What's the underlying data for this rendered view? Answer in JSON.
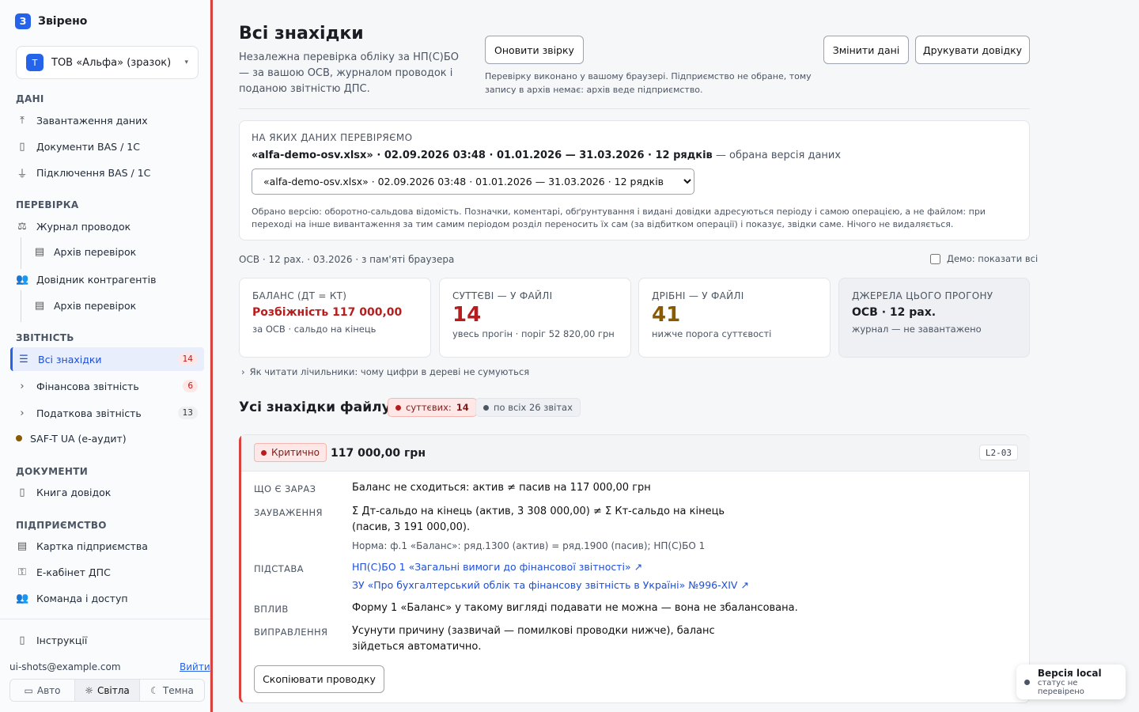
{
  "app": {
    "logo_letter": "З",
    "name": "Звірено"
  },
  "org": {
    "avatar": "Т",
    "name": "ТОВ «Альфа» (зразок)"
  },
  "sidebar": {
    "sections": {
      "data": "ДАНІ",
      "check": "ПЕРЕВІРКА",
      "report": "ЗВІТНІСТЬ",
      "docs": "ДОКУМЕНТИ",
      "enterprise": "ПІДПРИЄМСТВО"
    },
    "items": {
      "upload": "Завантаження даних",
      "bas_docs": "Документи BAS / 1С",
      "bas_conn": "Підключення BAS / 1С",
      "journal": "Журнал проводок",
      "archive1": "Архів перевірок",
      "contractors": "Довідник контрагентів",
      "archive2": "Архів перевірок",
      "all_findings": "Всі знахідки",
      "all_findings_count": "14",
      "fin_report": "Фінансова звітність",
      "fin_report_count": "6",
      "tax_report": "Податкова звітність",
      "tax_report_count": "13",
      "saft": "SAF-T UA (е-аудит)",
      "book": "Книга довідок",
      "card": "Картка підприємства",
      "cabinet": "Е-кабінет ДПС",
      "team": "Команда і доступ",
      "instructions": "Інструкції"
    },
    "email": "ui-shots@example.com",
    "logout": "Вийти",
    "theme": {
      "auto": "Авто",
      "light": "Світла",
      "dark": "Темна"
    }
  },
  "header": {
    "title": "Всі знахідки",
    "intro": "Незалежна перевірка обліку за НП(С)БО — за вашою ОСВ, журналом проводок і поданою звітністю ДПС.",
    "refresh": "Оновити звірку",
    "note": "Перевірку виконано у вашому браузері. Підприємство не обране, тому запису в архів немає: архів веде підприємство.",
    "change": "Змінити дані",
    "print": "Друкувати довідку"
  },
  "dataset": {
    "label": "НА ЯКИХ ДАНИХ ПЕРЕВІРЯЄМО",
    "current": "«alfa-demo-osv.xlsx» · 02.09.2026 03:48 · 01.01.2026 — 31.03.2026 · 12 рядків",
    "current_suffix": "— обрана версія даних",
    "select_value": "«alfa-demo-osv.xlsx» · 02.09.2026 03:48 · 01.01.2026 — 31.03.2026 · 12 рядків",
    "desc": "Обрано версію: оборотно-сальдова відомість. Позначки, коментарі, обґрунтування і видані довідки адресуються періоду і самою операцією, а не файлом: при переході на інше вивантаження за тим самим періодом розділ переносить їх сам (за відбитком операції) і показує, звідки саме. Нічого не видаляється."
  },
  "meta": {
    "left": "ОСВ · 12 рах. · 03.2026 · з пам'яті браузера",
    "demo": "Демо: показати всі"
  },
  "stats": [
    {
      "title": "БАЛАНС (ДТ = КТ)",
      "value": "Розбіжність 117 000,00",
      "sub": "за ОСВ · сальдо на кінець"
    },
    {
      "title": "СУТТЄВІ — У ФАЙЛІ",
      "value": "14",
      "sub": "увесь прогін · поріг 52 820,00 грн"
    },
    {
      "title": "ДРІБНІ — У ФАЙЛІ",
      "value": "41",
      "sub": "нижче порога суттєвості"
    },
    {
      "title": "ДЖЕРЕЛА ЦЬОГО ПРОГОНУ",
      "value": "ОСВ · 12 рах.",
      "sub": "журнал — не завантажено"
    }
  ],
  "colors": {
    "accent": "#2563eb",
    "danger": "#b91c1c",
    "gold": "#8a5a00",
    "rail": "#d9433d"
  },
  "howto": "Як читати лічильники: чому цифри в дереві не сумуються",
  "findings": {
    "title": "Усі знахідки файлу",
    "chip1_label": "суттєвих:",
    "chip1_count": "14",
    "chip2": "по всіх 26 звітах"
  },
  "finding": {
    "severity": "Критично",
    "amount": "117 000,00 грн",
    "code": "L2-03",
    "k_now": "ЩО Є ЗАРАЗ",
    "v_now": "Баланс не сходиться: актив ≠ пасив на 117 000,00 грн",
    "k_remark": "ЗАУВАЖЕННЯ",
    "v_remark": "Σ Дт-сальдо на кінець (актив, 3 308 000,00) ≠ Σ Кт-сальдо на кінець (пасив, 3 191 000,00).",
    "v_norm": "Норма: ф.1 «Баланс»: ряд.1300 (актив) = ряд.1900 (пасив); НП(С)БО 1",
    "k_basis": "ПІДСТАВА",
    "link1": "НП(С)БО 1 «Загальні вимоги до фінансової звітності» ↗",
    "link2": "ЗУ «Про бухгалтерський облік та фінансову звітність в Україні» №996-XIV ↗",
    "k_impact": "ВПЛИВ",
    "v_impact": "Форму 1 «Баланс» у такому вигляді подавати не можна — вона не збалансована.",
    "k_fix": "ВИПРАВЛЕННЯ",
    "v_fix": "Усунути причину (зазвичай — помилкові проводки нижче), баланс зійдеться автоматично.",
    "copy": "Скопіювати проводку"
  },
  "toast": {
    "title": "Версія local",
    "sub": "статус не перевірено"
  }
}
